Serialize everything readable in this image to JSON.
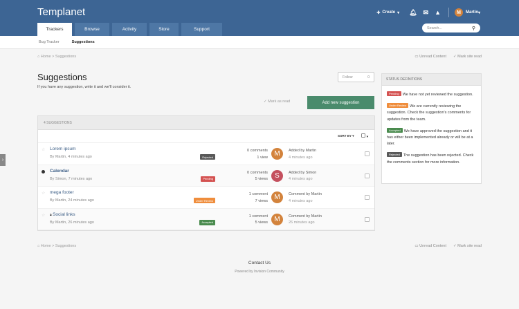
{
  "header": {
    "site_name": "Templanet",
    "create_label": "Create",
    "user_initial": "M",
    "user_name": "Martin",
    "search_placeholder": "Search..."
  },
  "tabs": [
    "Trackers",
    "Browse",
    "Activity",
    "Store",
    "Support"
  ],
  "subnav": {
    "item1": "Bug Tracker",
    "item2": "Suggestions"
  },
  "breadcrumb": {
    "home": "Home",
    "sep": ">",
    "current": "Suggestions"
  },
  "crumb_links": {
    "unread": "Unread Content",
    "mark_site": "Mark site read"
  },
  "page": {
    "title": "Suggestions",
    "subtitle": "If you have any suggestion, write it and we'll consider it.",
    "follow_label": "Follow",
    "follow_count": "0",
    "mark_read_label": "Mark as read",
    "add_button_label": "Add new suggestion"
  },
  "list": {
    "header_label": "4 SUGGESTIONS",
    "sort_label": "SORT BY",
    "rows": [
      {
        "title": "Lorem ipsum",
        "meta": "By Martin, 4 minutes ago",
        "badge": "Rejected",
        "badge_color": "#595959",
        "stat1": "0 comments",
        "stat2": "1 view",
        "avatar_initial": "M",
        "avatar_color": "#d3833c",
        "last_by": "Added by Martin",
        "last_time": "4 minutes ago",
        "unread": false,
        "locked": false
      },
      {
        "title": "Calendar",
        "meta": "By Simon, 7 minutes ago",
        "badge": "Pending",
        "badge_color": "#d45251",
        "stat1": "0 comments",
        "stat2": "5 views",
        "avatar_initial": "S",
        "avatar_color": "#c4505e",
        "last_by": "Added by Simon",
        "last_time": "4 minutes ago",
        "unread": true,
        "locked": false
      },
      {
        "title": "mega footer",
        "meta": "By Martin, 24 minutes ago",
        "badge": "Under Review",
        "badge_color": "#ef8d3c",
        "stat1": "1 comment",
        "stat2": "7 views",
        "avatar_initial": "M",
        "avatar_color": "#d3833c",
        "last_by": "Comment by Martin",
        "last_time": "4 minutes ago",
        "unread": false,
        "locked": false
      },
      {
        "title": "Social links",
        "meta": "By Martin, 26 minutes ago",
        "badge": "Accepted",
        "badge_color": "#4a8b4e",
        "stat1": "1 comment",
        "stat2": "5 views",
        "avatar_initial": "M",
        "avatar_color": "#d3833c",
        "last_by": "Comment by Martin",
        "last_time": "26 minutes ago",
        "unread": false,
        "locked": true
      }
    ]
  },
  "sidebar": {
    "title": "STATUS DEFINITIONS",
    "items": [
      {
        "badge": "Pending",
        "color": "#d45251",
        "text": "We have not yet reviewed the suggestion."
      },
      {
        "badge": "Under Review",
        "color": "#ef8d3c",
        "text": "We are currently reviewing the suggestion. Check the suggestion's comments for updates from the team."
      },
      {
        "badge": "Accepted",
        "color": "#4a8b4e",
        "text": "We have approved the suggestion and it has either been implemented already or will be at a later."
      },
      {
        "badge": "Rejected",
        "color": "#595959",
        "text": "The suggestion has been rejected. Check the comments section for more information."
      }
    ]
  },
  "footer": {
    "contact": "Contact Us",
    "powered": "Powered by Invision Community"
  },
  "icons": {
    "home": "home-icon",
    "bell": "bell-icon",
    "mail": "envelope-icon",
    "warn": "warning-icon",
    "search": "search-icon",
    "check": "check-icon",
    "star": "star-icon",
    "lock": "lock-icon"
  }
}
